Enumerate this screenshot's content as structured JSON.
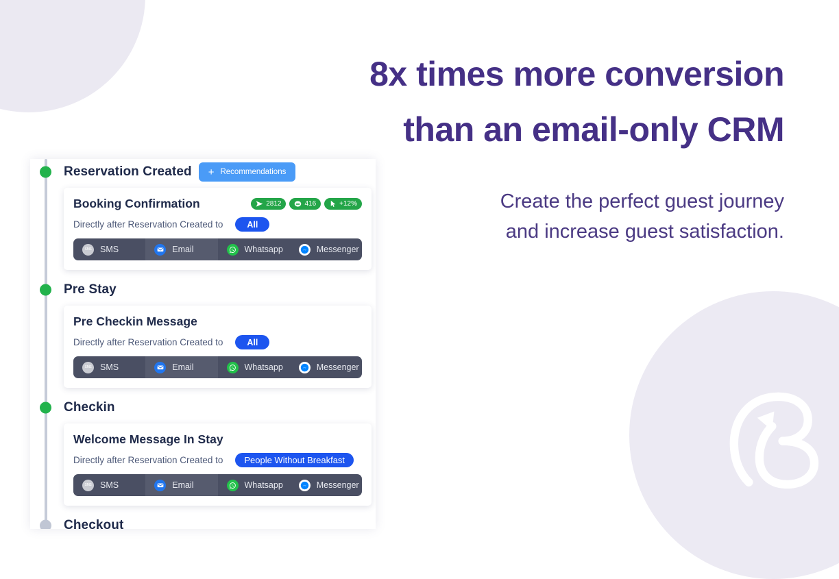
{
  "headline": {
    "line1": "8x times more conversion",
    "line2": "than an email-only CRM",
    "color": "#453086"
  },
  "subheadline": {
    "line1": "Create the perfect guest journey",
    "line2": "and increase guest satisfaction.",
    "color": "#4b3a83"
  },
  "journey": {
    "recommend_button": {
      "label": "Recommendations",
      "plus": "+",
      "color": "#4a9bf7"
    },
    "stages": [
      {
        "name": "Reservation Created",
        "dot_color": "#22b24c",
        "has_recommend_button": true,
        "card": {
          "title": "Booking Confirmation",
          "trigger_text": "Directly after Reservation Created to",
          "audience": "All",
          "audience_color": "#1d55ef",
          "stats": [
            {
              "icon": "send-icon",
              "value": "2812"
            },
            {
              "icon": "chat-bubble-icon",
              "value": "416"
            },
            {
              "icon": "cursor-click-icon",
              "value": "+12%"
            }
          ],
          "stat_color": "#23a548",
          "channels": [
            {
              "name": "SMS",
              "icon": "sms-icon",
              "icon_color": "#c9cbd2"
            },
            {
              "name": "Email",
              "icon": "envelope-icon",
              "icon_color": "#2176ee"
            },
            {
              "name": "Whatsapp",
              "icon": "whatsapp-icon",
              "icon_color": "#22c14a"
            },
            {
              "name": "Messenger",
              "icon": "messenger-icon",
              "icon_color": "#0084ff"
            }
          ]
        }
      },
      {
        "name": "Pre Stay",
        "dot_color": "#22b24c",
        "has_recommend_button": false,
        "card": {
          "title": "Pre Checkin Message",
          "trigger_text": "Directly after Reservation Created to",
          "audience": "All",
          "audience_color": "#1d55ef",
          "stats": [],
          "channels": [
            {
              "name": "SMS",
              "icon": "sms-icon",
              "icon_color": "#c9cbd2"
            },
            {
              "name": "Email",
              "icon": "envelope-icon",
              "icon_color": "#2176ee"
            },
            {
              "name": "Whatsapp",
              "icon": "whatsapp-icon",
              "icon_color": "#22c14a"
            },
            {
              "name": "Messenger",
              "icon": "messenger-icon",
              "icon_color": "#0084ff"
            }
          ]
        }
      },
      {
        "name": "Checkin",
        "dot_color": "#22b24c",
        "has_recommend_button": false,
        "card": {
          "title": "Welcome Message In Stay",
          "trigger_text": "Directly after Reservation Created to",
          "audience": "People Without Breakfast",
          "audience_color": "#1d55ef",
          "stats": [],
          "channels": [
            {
              "name": "SMS",
              "icon": "sms-icon",
              "icon_color": "#c9cbd2"
            },
            {
              "name": "Email",
              "icon": "envelope-icon",
              "icon_color": "#2176ee"
            },
            {
              "name": "Whatsapp",
              "icon": "whatsapp-icon",
              "icon_color": "#22c14a"
            },
            {
              "name": "Messenger",
              "icon": "messenger-icon",
              "icon_color": "#0084ff"
            }
          ]
        }
      },
      {
        "name": "Checkout",
        "dot_color": "#c0c6d4",
        "has_recommend_button": false,
        "card": null
      }
    ]
  },
  "decoration": {
    "corner_color": "#ebe9f2",
    "circle_color": "#eceaf3",
    "logo": "brand-b-logo"
  }
}
